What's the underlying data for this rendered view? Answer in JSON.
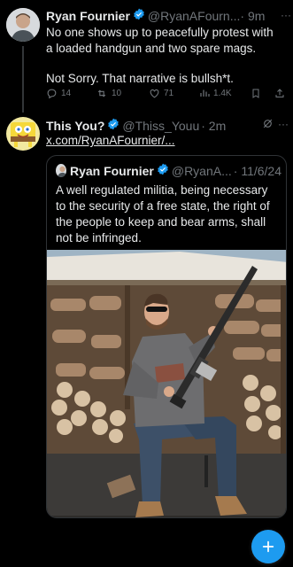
{
  "tweet1": {
    "name": "Ryan Fournier",
    "handle": "@RyanAFourn...",
    "time": "· 9m",
    "text_line1": "No one shows up to peacefully protest with",
    "text_line2": "a loaded handgun and two spare mags.",
    "text_line3": "Not Sorry. That narrative is bullsh*t.",
    "replies": "14",
    "reposts": "10",
    "likes": "71",
    "views": "1.4K"
  },
  "tweet2": {
    "name": "This You?",
    "handle": "@Thiss_Youu",
    "time": "· 2m",
    "link": "x.com/RyanAFournier/..."
  },
  "quote": {
    "name": "Ryan Fournier",
    "handle": "@RyanA...",
    "date": "· 11/6/24",
    "text_line1": "A well regulated militia, being necessary",
    "text_line2": "to the security of a free state, the right of",
    "text_line3": "the people to keep and bear arms, shall",
    "text_line4": "not be infringed."
  },
  "colors": {
    "background": "#000000",
    "text": "#e7e9ea",
    "muted": "#71767b",
    "accent": "#1d9bf0",
    "verified": "#1d9bf0"
  },
  "icons": [
    "reply-icon",
    "repost-icon",
    "like-icon",
    "views-icon",
    "bookmark-icon",
    "share-icon",
    "grok-icon",
    "more-icon",
    "verified-icon",
    "compose-icon"
  ]
}
